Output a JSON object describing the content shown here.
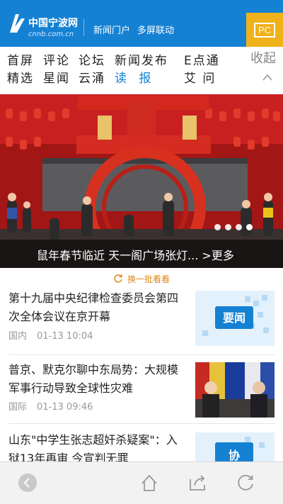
{
  "header": {
    "logo_name": "中国宁波网",
    "logo_domain": "cnnb.com.cn",
    "links": [
      "新闻门户",
      "多屏联动"
    ],
    "pc_label": "PC"
  },
  "nav": {
    "items": [
      {
        "line1": "首屏",
        "line2": "精选",
        "active": false
      },
      {
        "line1": "评论",
        "line2": "星闻",
        "active": false
      },
      {
        "line1": "论坛",
        "line2": "云涌",
        "active": false
      },
      {
        "line1": "新闻发布",
        "line2": "读  报",
        "active": true
      },
      {
        "line1": "E点通",
        "line2": "艾 问",
        "active": false
      }
    ],
    "collapse_label": "收起"
  },
  "carousel": {
    "caption": "鼠年春节临近 天一阁广场张灯... >更多",
    "dot_count": 4,
    "active_dot": 3
  },
  "refresh": {
    "label": "换一批看看"
  },
  "news": [
    {
      "title": "第十九届中央纪律检查委员会第四次全体会议在京开幕",
      "category": "国内",
      "time": "01-13 10:04",
      "thumb_text": "要闻"
    },
    {
      "title": "普京、默克尔聊中东局势：大规模军事行动导致全球性灾难",
      "category": "国际",
      "time": "01-13 09:46",
      "thumb_text": ""
    },
    {
      "title": "山东\"中学生张志超奸杀疑案\"：入狱13年再审 今宣判无罪",
      "category": "",
      "time": "",
      "thumb_text": "协"
    }
  ],
  "colors": {
    "brand_blue": "#1581d3",
    "pc_orange": "#f0b21a",
    "refresh_orange": "#e0861a"
  },
  "icons": {
    "bottom_bar": [
      "back-icon",
      "home-icon",
      "share-icon",
      "reload-icon"
    ]
  }
}
